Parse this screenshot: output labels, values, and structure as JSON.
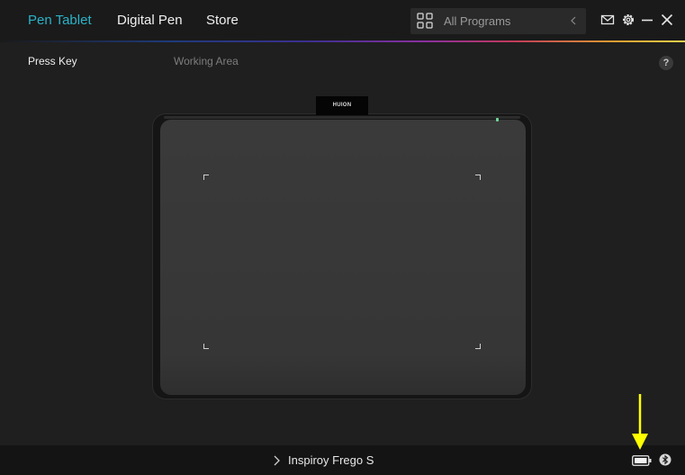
{
  "header": {
    "tabs": [
      {
        "label": "Pen Tablet",
        "active": true
      },
      {
        "label": "Digital Pen",
        "active": false
      },
      {
        "label": "Store",
        "active": false
      }
    ],
    "program_selector": {
      "label": "All Programs",
      "icon": "grid-icon",
      "chevron": "chevron-left-icon"
    },
    "icons": [
      "mail-icon",
      "gear-icon",
      "minimize-icon",
      "close-icon"
    ]
  },
  "subtabs": [
    {
      "label": "Press Key",
      "active": true
    },
    {
      "label": "Working Area",
      "active": false
    }
  ],
  "help": {
    "label": "?"
  },
  "tablet": {
    "brand": "HUION"
  },
  "footer": {
    "device_name": "Inspiroy Frego S",
    "battery_icon": "battery-icon",
    "bluetooth_icon": "bluetooth-icon"
  },
  "colors": {
    "accent": "#2bb3c8",
    "annotation_arrow": "#ffff00",
    "background": "#1f1f1f"
  }
}
